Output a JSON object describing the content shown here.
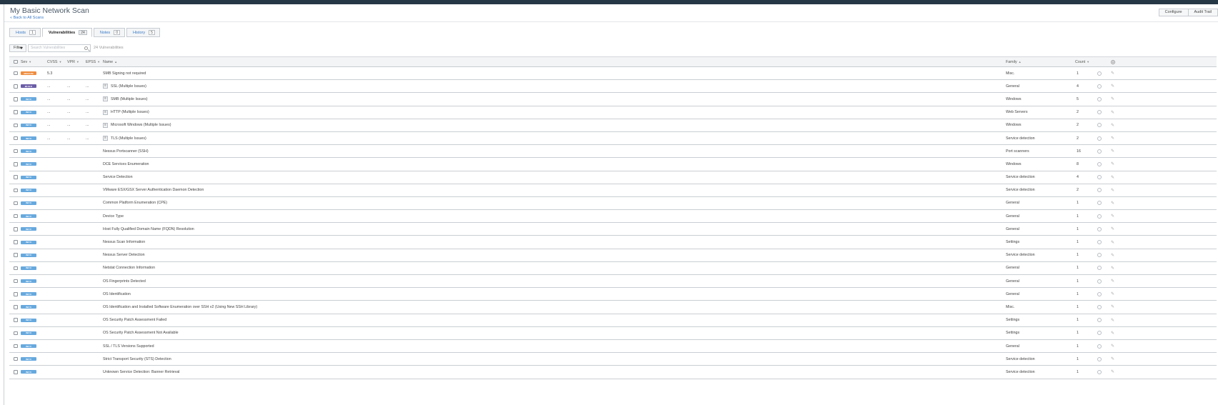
{
  "header": {
    "title": "My Basic Network Scan",
    "back_link": "« Back to All Scans",
    "buttons": [
      "Configure",
      "Audit Trail"
    ]
  },
  "tabs": [
    {
      "label": "Hosts",
      "count": "1"
    },
    {
      "label": "Vulnerabilities",
      "count": "24"
    },
    {
      "label": "Notes",
      "count": "0"
    },
    {
      "label": "History",
      "count": "5"
    }
  ],
  "filter": {
    "button_label": "Filter",
    "search_placeholder": "Search Vulnerabilities",
    "result_count": "24 Vulnerabilities"
  },
  "table": {
    "columns": {
      "sev": "Sev",
      "cvss": "CVSS",
      "vpr": "VPR",
      "epss": "EPSS",
      "name": "Name",
      "family": "Family",
      "count": "Count"
    },
    "rows": [
      {
        "sev": "MEDIUM",
        "sev_color": "#ee8c3d",
        "cvss": "5.3",
        "vpr": "",
        "epss": "",
        "group": false,
        "name": "SMB Signing not required",
        "family": "Misc.",
        "count": "1"
      },
      {
        "sev": "MIXED",
        "sev_color": "#6c5da7",
        "cvss": "...",
        "vpr": "...",
        "epss": "...",
        "group": true,
        "name": "SSL (Multiple Issues)",
        "family": "General",
        "count": "4"
      },
      {
        "sev": "INFO",
        "sev_color": "#67a9de",
        "cvss": "...",
        "vpr": "...",
        "epss": "...",
        "group": true,
        "name": "SMB (Multiple Issues)",
        "family": "Windows",
        "count": "5"
      },
      {
        "sev": "INFO",
        "sev_color": "#67a9de",
        "cvss": "...",
        "vpr": "...",
        "epss": "...",
        "group": true,
        "name": "HTTP (Multiple Issues)",
        "family": "Web Servers",
        "count": "2"
      },
      {
        "sev": "INFO",
        "sev_color": "#67a9de",
        "cvss": "...",
        "vpr": "...",
        "epss": "...",
        "group": true,
        "name": "Microsoft Windows (Multiple Issues)",
        "family": "Windows",
        "count": "2"
      },
      {
        "sev": "INFO",
        "sev_color": "#67a9de",
        "cvss": "...",
        "vpr": "...",
        "epss": "...",
        "group": true,
        "name": "TLS (Multiple Issues)",
        "family": "Service detection",
        "count": "2"
      },
      {
        "sev": "INFO",
        "sev_color": "#67a9de",
        "cvss": "",
        "vpr": "",
        "epss": "",
        "group": false,
        "name": "Nessus Portscanner (SSH)",
        "family": "Port scanners",
        "count": "16"
      },
      {
        "sev": "INFO",
        "sev_color": "#67a9de",
        "cvss": "",
        "vpr": "",
        "epss": "",
        "group": false,
        "name": "DCE Services Enumeration",
        "family": "Windows",
        "count": "8"
      },
      {
        "sev": "INFO",
        "sev_color": "#67a9de",
        "cvss": "",
        "vpr": "",
        "epss": "",
        "group": false,
        "name": "Service Detection",
        "family": "Service detection",
        "count": "4"
      },
      {
        "sev": "INFO",
        "sev_color": "#67a9de",
        "cvss": "",
        "vpr": "",
        "epss": "",
        "group": false,
        "name": "VMware ESX/GSX Server Authentication Daemon Detection",
        "family": "Service detection",
        "count": "2"
      },
      {
        "sev": "INFO",
        "sev_color": "#67a9de",
        "cvss": "",
        "vpr": "",
        "epss": "",
        "group": false,
        "name": "Common Platform Enumeration (CPE)",
        "family": "General",
        "count": "1"
      },
      {
        "sev": "INFO",
        "sev_color": "#67a9de",
        "cvss": "",
        "vpr": "",
        "epss": "",
        "group": false,
        "name": "Device Type",
        "family": "General",
        "count": "1"
      },
      {
        "sev": "INFO",
        "sev_color": "#67a9de",
        "cvss": "",
        "vpr": "",
        "epss": "",
        "group": false,
        "name": "Host Fully Qualified Domain Name (FQDN) Resolution",
        "family": "General",
        "count": "1"
      },
      {
        "sev": "INFO",
        "sev_color": "#67a9de",
        "cvss": "",
        "vpr": "",
        "epss": "",
        "group": false,
        "name": "Nessus Scan Information",
        "family": "Settings",
        "count": "1"
      },
      {
        "sev": "INFO",
        "sev_color": "#67a9de",
        "cvss": "",
        "vpr": "",
        "epss": "",
        "group": false,
        "name": "Nessus Server Detection",
        "family": "Service detection",
        "count": "1"
      },
      {
        "sev": "INFO",
        "sev_color": "#67a9de",
        "cvss": "",
        "vpr": "",
        "epss": "",
        "group": false,
        "name": "Netstat Connection Information",
        "family": "General",
        "count": "1"
      },
      {
        "sev": "INFO",
        "sev_color": "#67a9de",
        "cvss": "",
        "vpr": "",
        "epss": "",
        "group": false,
        "name": "OS Fingerprints Detected",
        "family": "General",
        "count": "1"
      },
      {
        "sev": "INFO",
        "sev_color": "#67a9de",
        "cvss": "",
        "vpr": "",
        "epss": "",
        "group": false,
        "name": "OS Identification",
        "family": "General",
        "count": "1"
      },
      {
        "sev": "INFO",
        "sev_color": "#67a9de",
        "cvss": "",
        "vpr": "",
        "epss": "",
        "group": false,
        "name": "OS Identification and Installed Software Enumeration over SSH v2 (Using New SSH Library)",
        "family": "Misc.",
        "count": "1"
      },
      {
        "sev": "INFO",
        "sev_color": "#67a9de",
        "cvss": "",
        "vpr": "",
        "epss": "",
        "group": false,
        "name": "OS Security Patch Assessment Failed",
        "family": "Settings",
        "count": "1"
      },
      {
        "sev": "INFO",
        "sev_color": "#67a9de",
        "cvss": "",
        "vpr": "",
        "epss": "",
        "group": false,
        "name": "OS Security Patch Assessment Not Available",
        "family": "Settings",
        "count": "1"
      },
      {
        "sev": "INFO",
        "sev_color": "#67a9de",
        "cvss": "",
        "vpr": "",
        "epss": "",
        "group": false,
        "name": "SSL / TLS Versions Supported",
        "family": "General",
        "count": "1"
      },
      {
        "sev": "INFO",
        "sev_color": "#67a9de",
        "cvss": "",
        "vpr": "",
        "epss": "",
        "group": false,
        "name": "Strict Transport Security (STS) Detection",
        "family": "Service detection",
        "count": "1"
      },
      {
        "sev": "INFO",
        "sev_color": "#67a9de",
        "cvss": "",
        "vpr": "",
        "epss": "",
        "group": false,
        "name": "Unknown Service Detection: Banner Retrieval",
        "family": "Service detection",
        "count": "1"
      }
    ]
  }
}
